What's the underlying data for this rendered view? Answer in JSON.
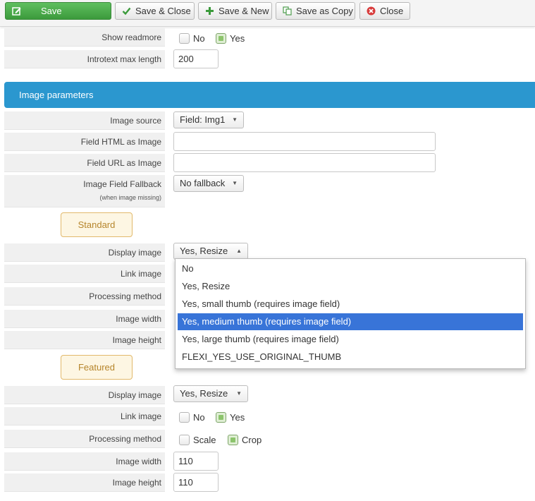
{
  "toolbar": {
    "save": "Save",
    "save_close": "Save & Close",
    "save_new": "Save & New",
    "save_copy": "Save as Copy",
    "close": "Close"
  },
  "colors": {
    "accent": "#2b97cf",
    "primary_button": "#4cae4c",
    "highlight": "#3874d8",
    "tag_border": "#e2b96c"
  },
  "intro": {
    "show_readmore": {
      "label": "Show readmore",
      "options": [
        "No",
        "Yes"
      ],
      "selected": "Yes"
    },
    "introtext_max_length": {
      "label": "Introtext max length",
      "value": "200"
    }
  },
  "image_params": {
    "title": "Image parameters",
    "image_source": {
      "label": "Image source",
      "value": "Field: Img1"
    },
    "field_html": {
      "label": "Field HTML as Image",
      "value": ""
    },
    "field_url": {
      "label": "Field URL as Image",
      "value": ""
    },
    "fallback": {
      "label": "Image Field Fallback",
      "sub": "(when image missing)",
      "value": "No fallback"
    }
  },
  "standard": {
    "title": "Standard",
    "display_image": {
      "label": "Display image",
      "value": "Yes, Resize"
    },
    "link_image": {
      "label": "Link image"
    },
    "processing_method": {
      "label": "Processing method"
    },
    "image_width": {
      "label": "Image width"
    },
    "image_height": {
      "label": "Image height"
    },
    "dropdown_options": [
      "No",
      "Yes, Resize",
      "Yes, small thumb (requires image field)",
      "Yes, medium thumb (requires image field)",
      "Yes, large thumb (requires image field)",
      "FLEXI_YES_USE_ORIGINAL_THUMB"
    ],
    "highlighted_option": "Yes, medium thumb (requires image field)"
  },
  "featured": {
    "title": "Featured",
    "display_image": {
      "label": "Display image",
      "value": "Yes, Resize"
    },
    "link_image": {
      "label": "Link image",
      "options": [
        "No",
        "Yes"
      ],
      "selected": "Yes"
    },
    "processing_method": {
      "label": "Processing method",
      "options": [
        "Scale",
        "Crop"
      ],
      "selected": "Crop"
    },
    "image_width": {
      "label": "Image width",
      "value": "110"
    },
    "image_height": {
      "label": "Image height",
      "value": "110"
    }
  }
}
